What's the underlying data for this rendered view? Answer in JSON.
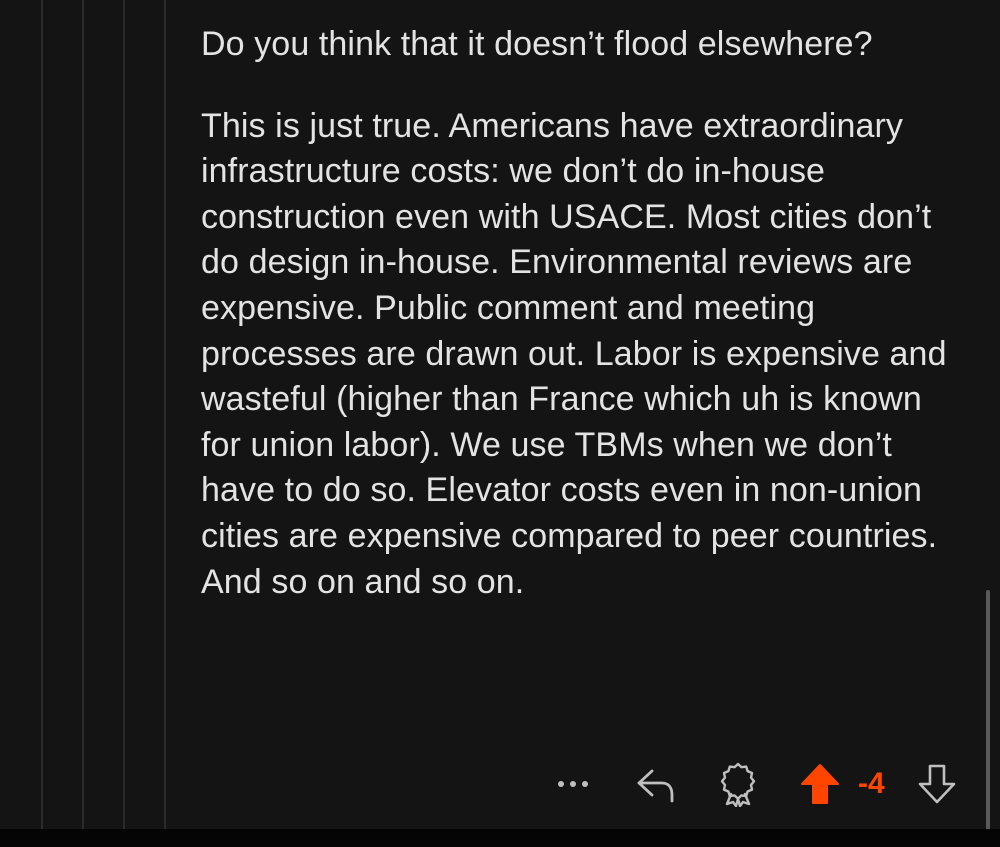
{
  "comment": {
    "paragraphs": [
      "Do you think that it doesn’t flood elsewhere?",
      "This is just true. Americans have extraordinary infrastructure costs: we don’t do in-house construction even with USACE. Most cities don’t do design in-house. Environmental reviews are expensive. Public comment and meeting processes are drawn out. Labor is expensive and wasteful (higher than France which uh is known for union labor). We use TBMs when we don’t have to do so. Elevator costs even in non-union cities are expensive compared to peer countries. And so on and so on."
    ]
  },
  "actions": {
    "more_icon": "more-horizontal-icon",
    "reply_icon": "reply-arrow-icon",
    "award_icon": "award-icon",
    "upvote_icon": "upvote-arrow-icon",
    "downvote_icon": "downvote-arrow-icon",
    "score": "-4",
    "upvoted": true
  },
  "colors": {
    "background": "#141414",
    "text": "#e3e3e3",
    "icon": "#bfbfbf",
    "upvote_accent": "#ff4500"
  }
}
